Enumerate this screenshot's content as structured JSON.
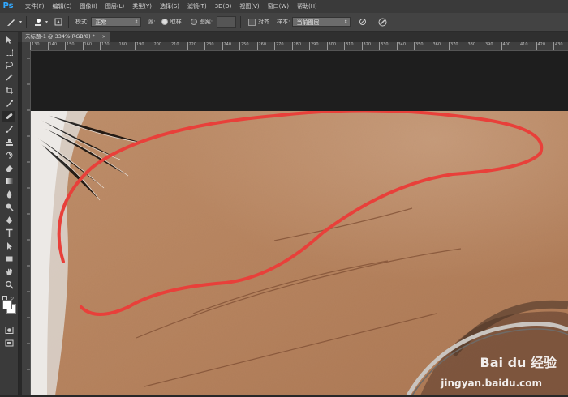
{
  "app": {
    "logo": "Ps"
  },
  "menubar": {
    "items": [
      "文件(F)",
      "编辑(E)",
      "图像(I)",
      "图层(L)",
      "类型(Y)",
      "选择(S)",
      "滤镜(T)",
      "3D(D)",
      "视图(V)",
      "窗口(W)",
      "帮助(H)"
    ]
  },
  "options": {
    "mode_label": "模式:",
    "mode_value": "正常",
    "source_label": "源:",
    "source_sampled": "取样",
    "source_pattern": "图案:",
    "aligned_label": "对齐",
    "sample_label": "样本:",
    "sample_value": "当前图层"
  },
  "document": {
    "tab_title": "未标题-1 @ 334%(RGB/8) *",
    "close": "×"
  },
  "ruler": {
    "ticks": [
      "130",
      "140",
      "150",
      "160",
      "170",
      "180",
      "190",
      "200",
      "210",
      "220",
      "230",
      "240",
      "250",
      "260",
      "270",
      "280",
      "290",
      "300",
      "310",
      "320",
      "330",
      "340",
      "350",
      "360",
      "370",
      "380",
      "390",
      "400",
      "410",
      "420",
      "430"
    ]
  },
  "watermark": {
    "brand": "Bai du 经验",
    "url": "jingyan.baidu.com"
  },
  "colors": {
    "accent": "#31a8ff",
    "stroke": "#e8403a",
    "skin": "#b98560"
  },
  "icons": [
    "move-icon",
    "marquee-icon",
    "lasso-icon",
    "magic-wand-icon",
    "crop-icon",
    "eyedropper-icon",
    "healing-brush-icon",
    "brush-icon",
    "clone-stamp-icon",
    "history-brush-icon",
    "eraser-icon",
    "gradient-icon",
    "blur-icon",
    "dodge-icon",
    "pen-icon",
    "type-icon",
    "path-select-icon",
    "rectangle-icon",
    "hand-icon",
    "zoom-icon",
    "color-swatch-icon",
    "quick-mask-icon",
    "screen-mode-icon"
  ]
}
